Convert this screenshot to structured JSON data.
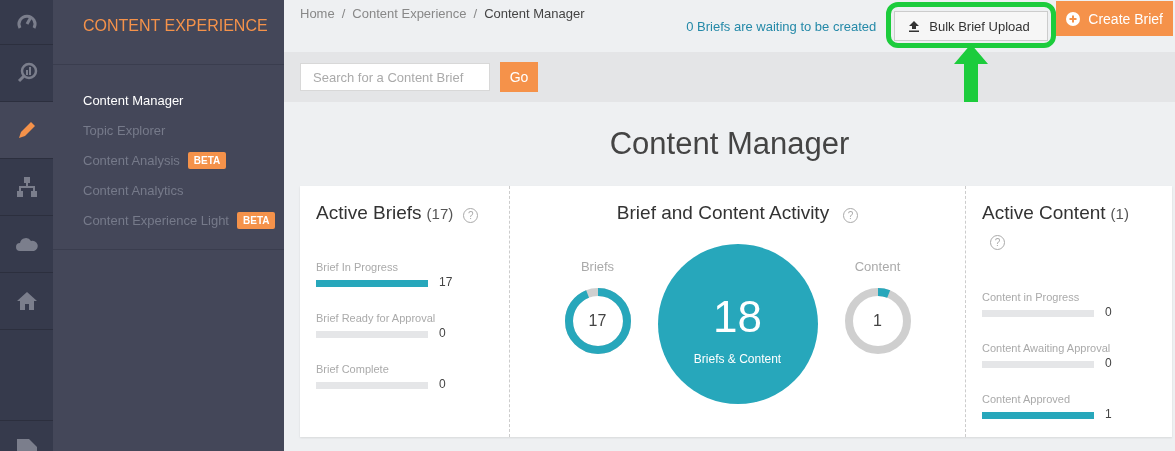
{
  "rail": [
    {
      "kind": "gauge",
      "selected": false
    },
    {
      "kind": "chart-search",
      "selected": false
    },
    {
      "kind": "pencil",
      "selected": true
    },
    {
      "kind": "sitemap",
      "selected": false
    },
    {
      "kind": "cloud",
      "selected": false
    },
    {
      "kind": "home",
      "selected": false
    },
    {
      "kind": "tag",
      "selected": false
    }
  ],
  "sidebar": {
    "title": "CONTENT EXPERIENCE",
    "items": [
      {
        "label": "Content Manager",
        "selected": true
      },
      {
        "label": "Topic Explorer",
        "selected": false
      },
      {
        "label": "Content Analysis",
        "badge": "BETA",
        "selected": false
      },
      {
        "label": "Content Analytics",
        "selected": false
      },
      {
        "label": "Content Experience Light",
        "badge": "BETA",
        "selected": false
      }
    ]
  },
  "breadcrumb": [
    "Home",
    "Content Experience",
    "Content Manager"
  ],
  "breadcrumb_separators": [
    "/",
    "/"
  ],
  "waiting_text": "0 Briefs are waiting to be created",
  "bulk_upload_button": "Bulk Brief Upload",
  "create_button": "Create Brief",
  "search": {
    "placeholder": "Search for a Content Brief",
    "button": "Go"
  },
  "page_title": "Content Manager",
  "active_briefs": {
    "title": "Active Briefs",
    "count": "(17)",
    "help": "?",
    "rows": [
      {
        "label": "Brief In Progress",
        "level": 1,
        "value": "17"
      },
      {
        "label": "Brief Ready for Approval",
        "level": 0,
        "value": "0"
      },
      {
        "label": "Brief Complete",
        "level": 0,
        "value": "0"
      }
    ]
  },
  "activity": {
    "title": "Brief and Content Activity",
    "help": "?",
    "briefs": {
      "label": "Briefs",
      "value": "17",
      "level": 0.94
    },
    "total": {
      "value": "18",
      "label": "Briefs & Content"
    },
    "content": {
      "label": "Content",
      "value": "1",
      "level": 0.06
    }
  },
  "active_content": {
    "title": "Active Content",
    "count": "(1)",
    "help": "?",
    "rows": [
      {
        "label": "Content in Progress",
        "level": 0,
        "value": "0"
      },
      {
        "label": "Content Awaiting Approval",
        "level": 0,
        "value": "0"
      },
      {
        "label": "Content Approved",
        "level": 1,
        "value": "1"
      }
    ]
  }
}
